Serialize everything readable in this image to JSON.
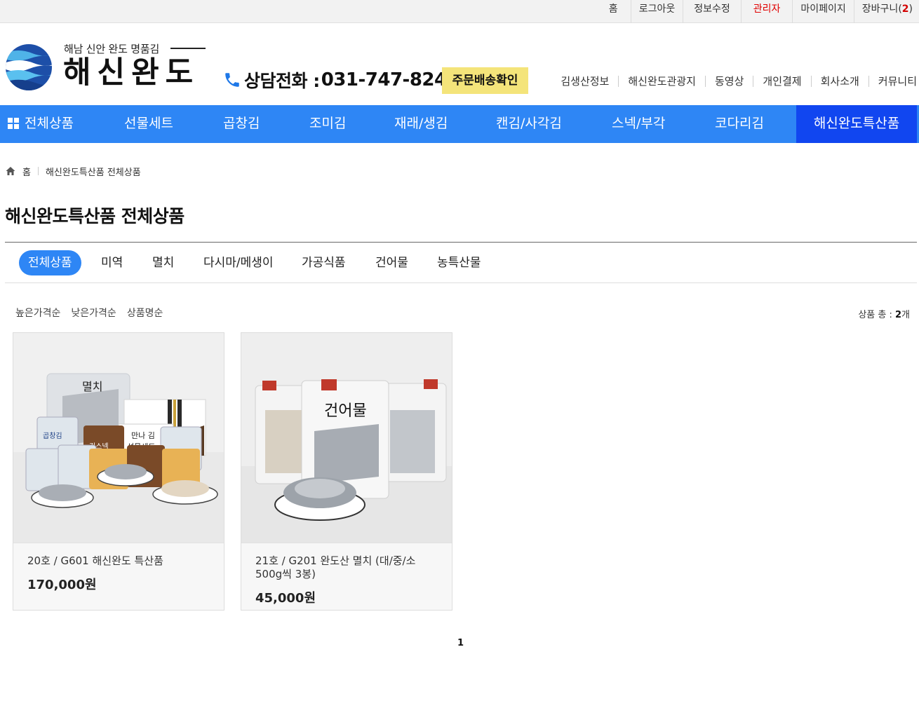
{
  "topbar": {
    "links": [
      "홈",
      "로그아웃",
      "정보수정",
      "관리자",
      "마이페이지"
    ],
    "cart_label": "장바구니(",
    "cart_count": "2",
    "cart_close": ")"
  },
  "header": {
    "logo_sub": "해남 신안 완도 명품김",
    "logo_title": "해신완도",
    "phone_label": "상담전화 :",
    "phone_number": "031-747-8242",
    "ship_button": "주문배송확인",
    "links": [
      "김생산정보",
      "해신완도관광지",
      "동영상",
      "개인결제",
      "회사소개",
      "커뮤니티"
    ]
  },
  "nav": {
    "items": [
      "전체상품",
      "선물세트",
      "곱창김",
      "조미김",
      "재래/생김",
      "캔김/사각김",
      "스넥/부각",
      "코다리김",
      "해신완도특산품"
    ],
    "active_color": "#1146f0",
    "bar_color": "#2e86f5"
  },
  "breadcrumb": {
    "home": "홈",
    "current": "해신완도특산품 전체상품"
  },
  "page_title": "해신완도특산품 전체상품",
  "subcategories": [
    "전체상품",
    "미역",
    "멸치",
    "다시마/메생이",
    "가공식품",
    "건어물",
    "농특산물"
  ],
  "sort": [
    "높은가격순",
    "낮은가격순",
    "상품명순"
  ],
  "total": {
    "label": "상품 총 :",
    "count": "2",
    "unit": "개"
  },
  "products": [
    {
      "name": "20호 / G601 해신완도 특산품",
      "price": "170,000원"
    },
    {
      "name": "21호 / G201 완도산 멸치 (대/중/소 500g씩 3봉)",
      "price": "45,000원"
    }
  ],
  "images": {
    "p1": {
      "can_labels": [
        "곱창김",
        "김스넥",
        "만나 김",
        "선물세트"
      ],
      "bag_label": "멸치"
    },
    "p2": {
      "bag_label": "건어물"
    }
  },
  "pager": {
    "current": "1"
  }
}
